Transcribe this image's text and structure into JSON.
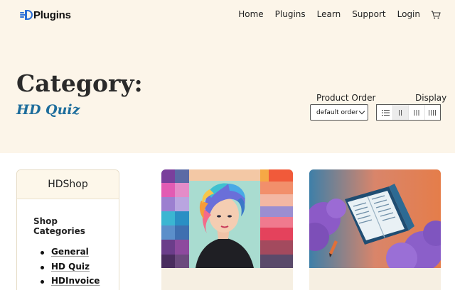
{
  "brand": {
    "name": "Plugins"
  },
  "nav": {
    "items": [
      "Home",
      "Plugins",
      "Learn",
      "Support",
      "Login"
    ],
    "cart_icon": "cart-icon"
  },
  "category": {
    "heading": "Category:",
    "name": "HD Quiz"
  },
  "controls": {
    "order_label": "Product Order",
    "order_value": "default order",
    "display_label": "Display",
    "display_modes": [
      "list-view-icon",
      "two-column-icon",
      "three-column-icon",
      "four-column-icon"
    ],
    "active_mode": "two-column-icon"
  },
  "sidebar": {
    "title": "HDShop",
    "section_title": "Shop Categories",
    "categories": [
      "General",
      "HD Quiz",
      "HDInvoice"
    ]
  },
  "products": [
    {
      "image_icon": "woman-portrait-color-swatches-image"
    },
    {
      "image_icon": "open-book-illustration-image"
    }
  ],
  "colors": {
    "hero_bg": "#fcf5e9",
    "accent_blue": "#1d6d9c",
    "logo_blue": "#2b6fd6"
  }
}
